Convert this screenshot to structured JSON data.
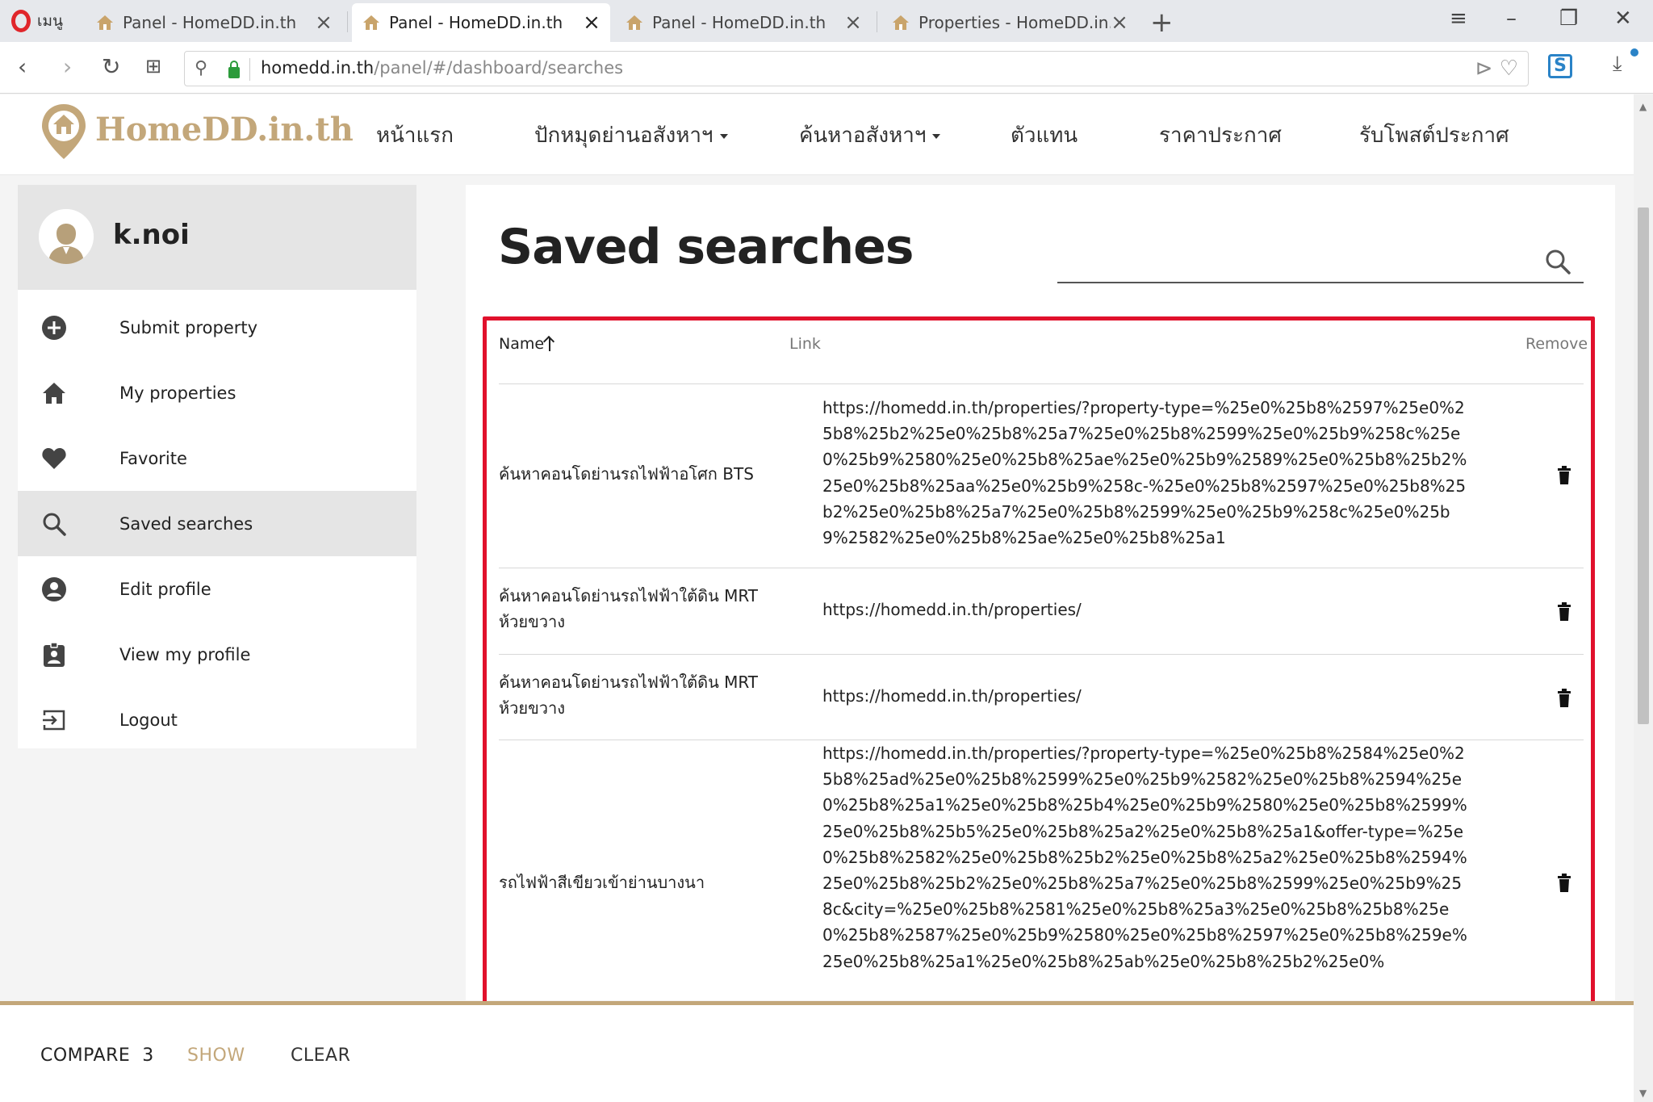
{
  "browser": {
    "menu_label": "เมนู",
    "tabs": [
      {
        "title": "Panel - HomeDD.in.th",
        "active": false
      },
      {
        "title": "Panel - HomeDD.in.th",
        "active": true
      },
      {
        "title": "Panel - HomeDD.in.th",
        "active": false
      },
      {
        "title": "Properties - HomeDD.in.th",
        "active": false
      }
    ],
    "url_domain": "homedd.in.th",
    "url_path": "/panel/#/dashboard/searches"
  },
  "site": {
    "logo_text": "HomeDD.in.th",
    "nav": [
      {
        "label": "หน้าแรก",
        "dropdown": false
      },
      {
        "label": "ปักหมุดย่านอสังหาฯ",
        "dropdown": true
      },
      {
        "label": "ค้นหาอสังหาฯ",
        "dropdown": true
      },
      {
        "label": "ตัวแทน",
        "dropdown": false
      },
      {
        "label": "ราคาประกาศ",
        "dropdown": false
      },
      {
        "label": "รับโพสต์ประกาศ",
        "dropdown": false
      }
    ]
  },
  "sidebar": {
    "username": "k.noi",
    "items": [
      {
        "label": "Submit property",
        "icon": "plus-circle-icon",
        "active": false
      },
      {
        "label": "My properties",
        "icon": "home-icon",
        "active": false
      },
      {
        "label": "Favorite",
        "icon": "heart-icon",
        "active": false
      },
      {
        "label": "Saved searches",
        "icon": "search-icon",
        "active": true
      },
      {
        "label": "Edit profile",
        "icon": "account-circle-icon",
        "active": false
      },
      {
        "label": "View my profile",
        "icon": "badge-icon",
        "active": false
      },
      {
        "label": "Logout",
        "icon": "logout-icon",
        "active": false
      }
    ]
  },
  "main": {
    "title": "Saved searches",
    "columns": {
      "name": "Name",
      "link": "Link",
      "remove": "Remove"
    },
    "rows": [
      {
        "name": "ค้นหาคอนโดย่านรถไฟฟ้าอโศก BTS",
        "link": "https://homedd.in.th/properties/?property-type=%25e0%25b8%2597%25e0%25b8%25b2%25e0%25b8%25a7%25e0%25b8%2599%25e0%25b9%258c%25e0%25b9%2580%25e0%25b8%25ae%25e0%25b9%2589%25e0%25b8%25b2%25e0%25b8%25aa%25e0%25b9%258c-%25e0%25b8%2597%25e0%25b8%25b2%25e0%25b8%25a7%25e0%25b8%2599%25e0%25b9%258c%25e0%25b9%2582%25e0%25b8%25ae%25e0%25b8%25a1"
      },
      {
        "name": "ค้นหาคอนโดย่านรถไฟฟ้าใต้ดิน MRT ห้วยขวาง",
        "link": "https://homedd.in.th/properties/"
      },
      {
        "name": "ค้นหาคอนโดย่านรถไฟฟ้าใต้ดิน MRT ห้วยขวาง",
        "link": "https://homedd.in.th/properties/"
      },
      {
        "name": "รถไฟฟ้าสีเขียวเข้าย่านบางนา",
        "link": "https://homedd.in.th/properties/?property-type=%25e0%25b8%2584%25e0%25b8%25ad%25e0%25b8%2599%25e0%25b9%2582%25e0%25b8%2594%25e0%25b8%25a1%25e0%25b8%25b4%25e0%25b9%2580%25e0%25b8%2599%25e0%25b8%25b5%25e0%25b8%25a2%25e0%25b8%25a1&offer-type=%25e0%25b8%2582%25e0%25b8%25b2%25e0%25b8%25a2%25e0%25b8%2594%25e0%25b8%25b2%25e0%25b8%25a7%25e0%25b8%2599%25e0%25b9%258c&city=%25e0%25b8%2581%25e0%25b8%25a3%25e0%25b8%25b8%25e0%25b8%2587%25e0%25b9%2580%25e0%25b8%2597%25e0%25b8%259e%25e0%25b8%25a1%25e0%25b8%25ab%25e0%25b8%25b2%25e0%"
      }
    ]
  },
  "compare": {
    "label": "COMPARE",
    "count": "3",
    "show": "SHOW",
    "clear": "CLEAR"
  },
  "colors": {
    "accent_gold": "#c3a77a",
    "highlight_red": "#e1112c",
    "opera_red": "#e0262b"
  }
}
